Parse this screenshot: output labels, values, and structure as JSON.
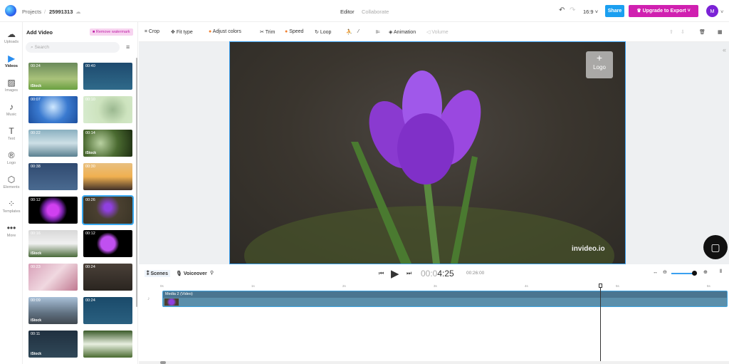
{
  "topbar": {
    "breadcrumb_root": "Projects",
    "separator": "/",
    "project_id": "25991313",
    "tab_editor": "Editor",
    "tab_collaborate": "Collaborate",
    "aspect": "16:9",
    "share": "Share",
    "upgrade": "Upgrade to Export",
    "avatar": "M"
  },
  "rail": [
    {
      "label": "Uploads",
      "icon": "☁"
    },
    {
      "label": "Videos",
      "icon": "▶"
    },
    {
      "label": "Images",
      "icon": "▨"
    },
    {
      "label": "Music",
      "icon": "♪"
    },
    {
      "label": "Text",
      "icon": "T"
    },
    {
      "label": "Logo",
      "icon": "®"
    },
    {
      "label": "Elements",
      "icon": "⬡"
    },
    {
      "label": "Templates",
      "icon": "⁘"
    },
    {
      "label": "More",
      "icon": "•••"
    }
  ],
  "panel": {
    "title": "Add Video",
    "watermark": "Remove watermark",
    "search_placeholder": "Search"
  },
  "thumbs": [
    {
      "dur": "00:24",
      "istock": "iStock",
      "bg": "linear-gradient(#6a8a5a,#a9c27a 60%,#6aa040)"
    },
    {
      "dur": "00:40",
      "istock": "",
      "bg": "linear-gradient(#1e4a6e,#2f6a8a)"
    },
    {
      "dur": "00:07",
      "istock": "",
      "bg": "radial-gradient(circle at 50% 40%,#cfe8ff,#3a7ad0 50%,#1d4f9e)"
    },
    {
      "dur": "00:10",
      "istock": "",
      "bg": "radial-gradient(circle at 60% 50%,#9bb890,#cde3be 45%,#d8ecd0)"
    },
    {
      "dur": "00:22",
      "istock": "",
      "bg": "linear-gradient(#8ab0c0,#cde0e6 50%,#5a8090)"
    },
    {
      "dur": "00:14",
      "istock": "iStock",
      "bg": "radial-gradient(circle at 35% 50%,#b8d0a0,#4a6a30 50%,#1e2e12)"
    },
    {
      "dur": "00:38",
      "istock": "",
      "bg": "linear-gradient(#304a70,#4a6a90)"
    },
    {
      "dur": "00:30",
      "istock": "",
      "bg": "linear-gradient(#e8c080,#f0b050 50%,#403028)"
    },
    {
      "dur": "00:12",
      "istock": "",
      "bg": "radial-gradient(circle,#d040f0 20%,#7020a0 35%,#000 50%)"
    },
    {
      "dur": "00:26",
      "istock": "",
      "bg": "radial-gradient(circle at 50% 40%,#9040e0 12%,#4a4030 40%,#3a3426)"
    },
    {
      "dur": "00:16",
      "istock": "iStock",
      "bg": "linear-gradient(#d8d8d8,#f0f0f0 50%,#4a6a3a)"
    },
    {
      "dur": "00:12",
      "istock": "",
      "bg": "radial-gradient(circle,#c050f0 25%,#000 40%)"
    },
    {
      "dur": "00:23",
      "istock": "",
      "bg": "linear-gradient(135deg,#d8a0b8,#f0d8e0 50%,#c07890)"
    },
    {
      "dur": "00:24",
      "istock": "",
      "bg": "linear-gradient(#4a4038,#2a2520)"
    },
    {
      "dur": "00:09",
      "istock": "iStock",
      "bg": "linear-gradient(#a8c0d8,#607080 60%,#404850)"
    },
    {
      "dur": "00:24",
      "istock": "",
      "bg": "linear-gradient(#1a4a6a,#2a6080)"
    },
    {
      "dur": "00:11",
      "istock": "iStock",
      "bg": "linear-gradient(#203040,#304858)"
    },
    {
      "dur": "",
      "istock": "",
      "bg": "linear-gradient(#3a5a2a,#e8efe0 50%,#4a6a30)"
    }
  ],
  "toolbar": {
    "crop": "Crop",
    "fit": "Fit type",
    "adjust": "Adjust colors",
    "trim": "Trim",
    "speed": "Speed",
    "loop": "Loop",
    "animation": "Animation",
    "volume": "Volume"
  },
  "stage": {
    "logo_label": "Logo",
    "watermark": "invideo.io"
  },
  "controls": {
    "scenes": "Scenes",
    "voiceover": "Voiceover",
    "time_current_dim": "00:0",
    "time_current": "4:25",
    "time_total": "00:26:00"
  },
  "timeline": {
    "ticks": [
      "0s",
      "1s",
      "2s",
      "3s",
      "4s",
      "5s",
      "6s"
    ],
    "clip_label": "Media 2 (Video)"
  }
}
